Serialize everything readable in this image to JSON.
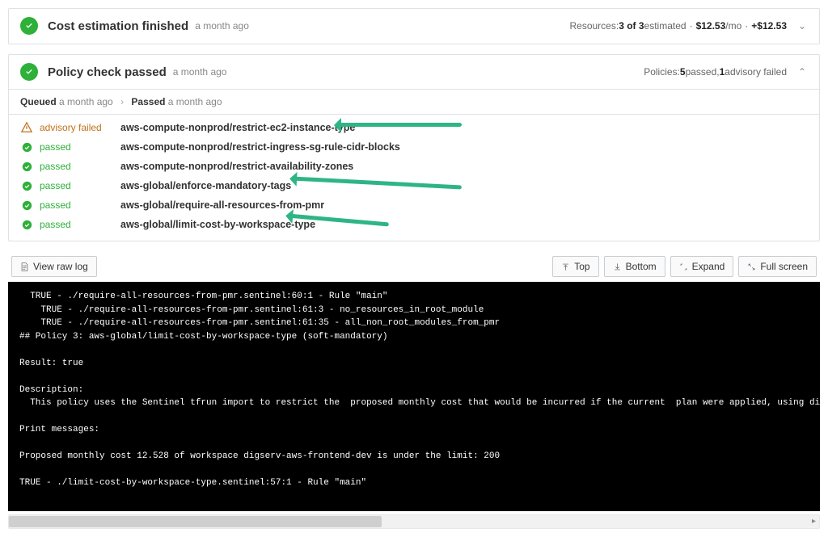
{
  "cost_panel": {
    "title": "Cost estimation finished",
    "time": "a month ago",
    "summary_resources_prefix": "Resources: ",
    "summary_resources_value": "3 of 3",
    "summary_resources_suffix": " estimated",
    "summary_cost_mo": "$12.53",
    "summary_cost_mo_suffix": "/mo",
    "summary_cost_delta": "+$12.53"
  },
  "policy_panel": {
    "title": "Policy check passed",
    "time": "a month ago",
    "summary_prefix": "Policies: ",
    "passed_count": "5",
    "passed_label": " passed, ",
    "failed_count": "1",
    "failed_label": " advisory failed",
    "breadcrumb": {
      "q_label": "Queued",
      "q_time": "a month ago",
      "p_label": "Passed",
      "p_time": "a month ago"
    },
    "rows": [
      {
        "status": "advisory failed",
        "type": "adv",
        "name": "aws-compute-nonprod/restrict-ec2-instance-type"
      },
      {
        "status": "passed",
        "type": "pass",
        "name": "aws-compute-nonprod/restrict-ingress-sg-rule-cidr-blocks"
      },
      {
        "status": "passed",
        "type": "pass",
        "name": "aws-compute-nonprod/restrict-availability-zones"
      },
      {
        "status": "passed",
        "type": "pass",
        "name": "aws-global/enforce-mandatory-tags"
      },
      {
        "status": "passed",
        "type": "pass",
        "name": "aws-global/require-all-resources-from-pmr"
      },
      {
        "status": "passed",
        "type": "pass",
        "name": "aws-global/limit-cost-by-workspace-type"
      }
    ]
  },
  "toolbar": {
    "view_raw_log": "View raw log",
    "top": "Top",
    "bottom": "Bottom",
    "expand": "Expand",
    "full_screen": "Full screen"
  },
  "terminal_text": "  TRUE - ./require-all-resources-from-pmr.sentinel:60:1 - Rule \"main\"\n    TRUE - ./require-all-resources-from-pmr.sentinel:61:3 - no_resources_in_root_module\n    TRUE - ./require-all-resources-from-pmr.sentinel:61:35 - all_non_root_modules_from_pmr\n## Policy 3: aws-global/limit-cost-by-workspace-type (soft-mandatory)\n\nResult: true\n\nDescription:\n  This policy uses the Sentinel tfrun import to restrict the  proposed monthly cost that would be incurred if the current  plan were applied, using different limits for different  workspaces based\n\nPrint messages:\n\nProposed monthly cost 12.528 of workspace digserv-aws-frontend-dev is under the limit: 200\n\nTRUE - ./limit-cost-by-workspace-type.sentinel:57:1 - Rule \"main\""
}
